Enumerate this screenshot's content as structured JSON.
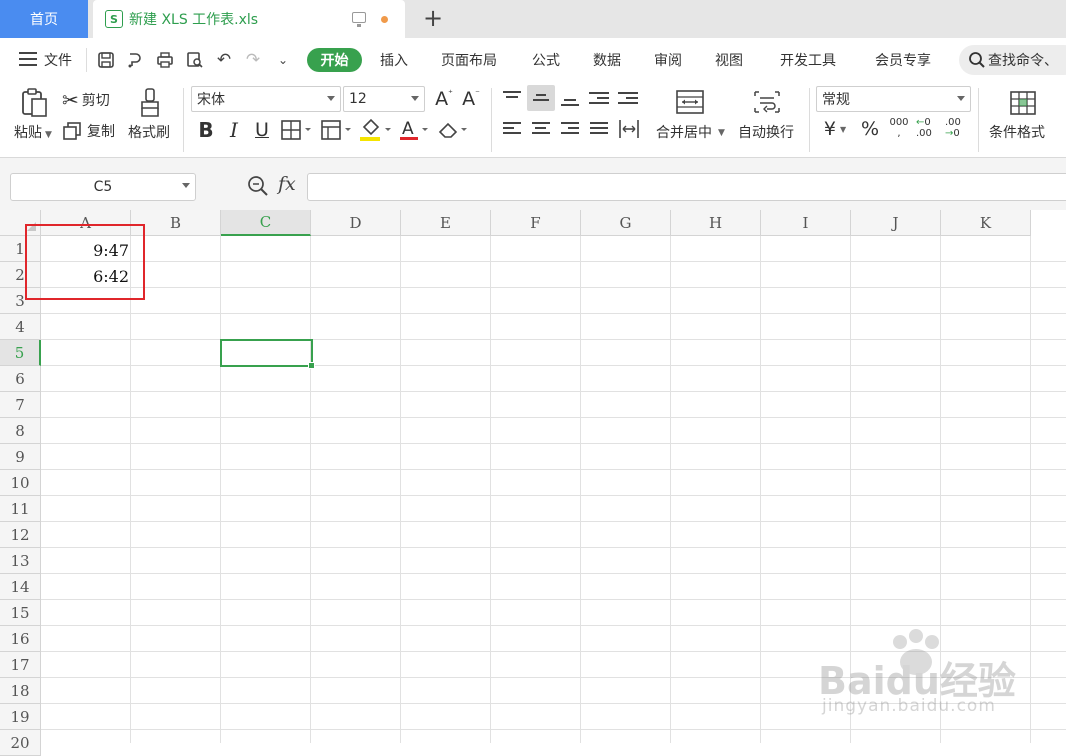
{
  "tabs": {
    "home": "首页",
    "doc_title": "新建 XLS 工作表.xls",
    "doc_icon_letter": "S"
  },
  "menu": {
    "file": "文件",
    "items": [
      "开始",
      "插入",
      "页面布局",
      "公式",
      "数据",
      "审阅",
      "视图",
      "开发工具",
      "会员专享"
    ],
    "search_placeholder": "查找命令、"
  },
  "toolbar": {
    "paste": "粘贴",
    "cut": "剪切",
    "copy": "复制",
    "format_painter": "格式刷",
    "font_name": "宋体",
    "font_size": "12",
    "merge_center": "合并居中",
    "wrap_text": "自动换行",
    "number_format": "常规",
    "conditional_format": "条件格式",
    "currency_symbol": "¥",
    "percent_symbol": "%"
  },
  "formula_bar": {
    "name_box": "C5",
    "fx": "fx",
    "value": ""
  },
  "sheet": {
    "columns": [
      "A",
      "B",
      "C",
      "D",
      "E",
      "F",
      "G",
      "H",
      "I",
      "J",
      "K"
    ],
    "rows": [
      "1",
      "2",
      "3",
      "4",
      "5",
      "6",
      "7",
      "8",
      "9",
      "10",
      "11",
      "12",
      "13",
      "14",
      "15",
      "16",
      "17",
      "18",
      "19",
      "20"
    ],
    "active_cell": "C5",
    "cells": {
      "A1": "9:47",
      "A2": "6:42"
    }
  },
  "colors": {
    "accent_green": "#38a14e",
    "home_tab_blue": "#4a8cf0",
    "highlight_red": "#e0262b"
  },
  "watermark": {
    "brand": "Baidu经验",
    "url": "jingyan.baidu.com"
  }
}
